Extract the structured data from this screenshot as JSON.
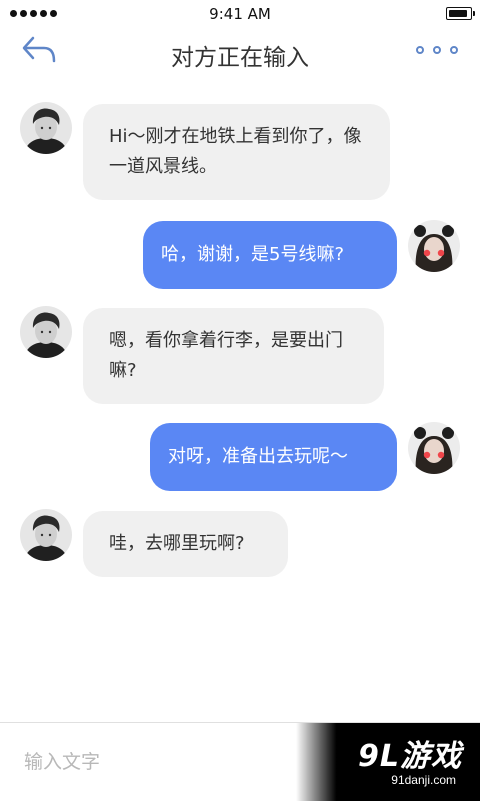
{
  "status_bar": {
    "time": "9:41 AM"
  },
  "nav": {
    "title": "对方正在输入"
  },
  "messages": [
    {
      "sender": "other",
      "text": "Hi～刚才在地铁上看到你了，像一道风景线。"
    },
    {
      "sender": "me",
      "text": "哈，谢谢，是5号线嘛?"
    },
    {
      "sender": "other",
      "text": "嗯，看你拿着行李，是要出门嘛?"
    },
    {
      "sender": "me",
      "text": "对呀，准备出去玩呢～"
    },
    {
      "sender": "other",
      "text": "哇，去哪里玩啊?"
    }
  ],
  "input": {
    "placeholder": "输入文字"
  },
  "watermark": {
    "logo": "9L游戏",
    "url": "91danji.com"
  },
  "colors": {
    "accent": "#5a87f4",
    "incoming_bubble": "#f0f0f0",
    "icon": "#5f86c8"
  }
}
